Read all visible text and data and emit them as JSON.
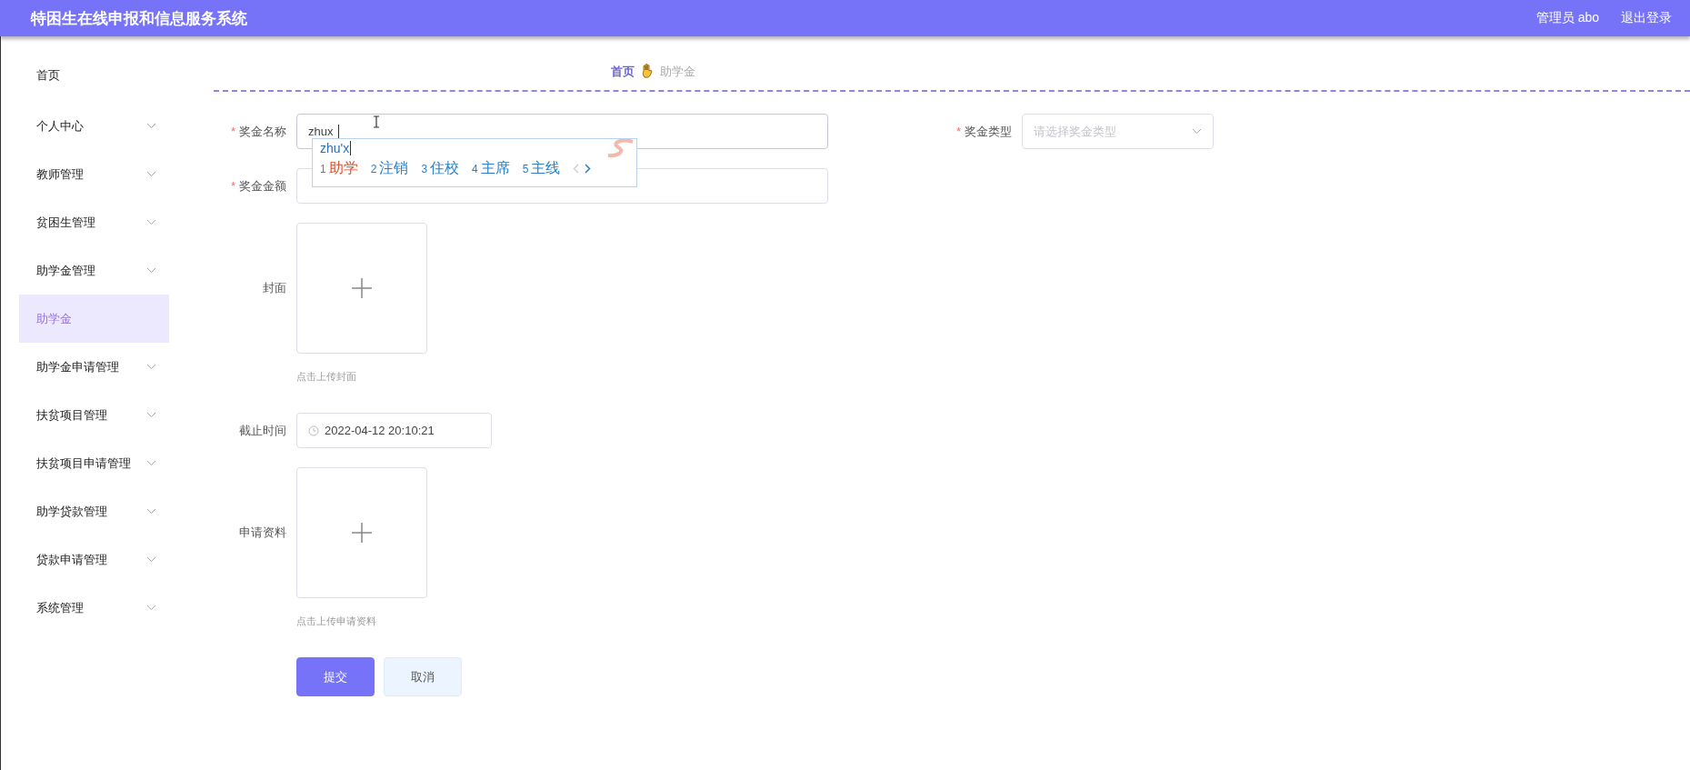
{
  "header": {
    "title": "特困生在线申报和信息服务系统",
    "user": "管理员 abo",
    "logout": "退出登录"
  },
  "sidebar": {
    "items": [
      {
        "label": "首页",
        "kind": "item",
        "selected": false
      },
      {
        "label": "个人中心",
        "kind": "submenu",
        "selected": false
      },
      {
        "label": "教师管理",
        "kind": "submenu",
        "selected": false
      },
      {
        "label": "贫困生管理",
        "kind": "submenu",
        "selected": false
      },
      {
        "label": "助学金管理",
        "kind": "submenu",
        "selected": false
      },
      {
        "label": "助学金",
        "kind": "item",
        "selected": true
      },
      {
        "label": "助学金申请管理",
        "kind": "submenu",
        "selected": false
      },
      {
        "label": "扶贫项目管理",
        "kind": "submenu",
        "selected": false
      },
      {
        "label": "扶贫项目申请管理",
        "kind": "submenu",
        "selected": false
      },
      {
        "label": "助学贷款管理",
        "kind": "submenu",
        "selected": false
      },
      {
        "label": "贷款申请管理",
        "kind": "submenu",
        "selected": false
      },
      {
        "label": "系统管理",
        "kind": "submenu",
        "selected": false
      }
    ]
  },
  "breadcrumb": [
    {
      "label": "首页",
      "selected": false
    },
    {
      "label": "助学金",
      "selected": true
    }
  ],
  "form": {
    "rows": [
      [
        {
          "kind": "text",
          "label": "奖金名称",
          "required_mark": "*",
          "value": "zhux",
          "focused": true,
          "ime": {
            "composition": "zhu'x",
            "candidates": [
              {
                "index": "1",
                "text": "助学",
                "selected": true
              },
              {
                "index": "2",
                "text": "注销",
                "selected": false
              },
              {
                "index": "3",
                "text": "住校",
                "selected": false
              },
              {
                "index": "4",
                "text": "主席",
                "selected": false
              },
              {
                "index": "5",
                "text": "主线",
                "selected": false
              }
            ]
          }
        },
        {
          "kind": "select",
          "label": "奖金类型",
          "required_mark": "*",
          "placeholder": "请选择奖金类型"
        }
      ],
      [
        {
          "kind": "text",
          "label": "奖金金额",
          "required_mark": "*"
        }
      ],
      [
        {
          "kind": "upload",
          "label": "封面",
          "hint": "点击上传封面"
        }
      ],
      [
        {
          "kind": "datetime",
          "label": "截止时间",
          "value": "2022-04-12 20:10:21"
        }
      ],
      [
        {
          "kind": "upload",
          "label": "申请资料",
          "hint": "点击上传申请资料"
        }
      ]
    ],
    "buttons": [
      {
        "label": "提交",
        "kind": "primary"
      },
      {
        "label": "取消",
        "kind": "default"
      }
    ]
  }
}
